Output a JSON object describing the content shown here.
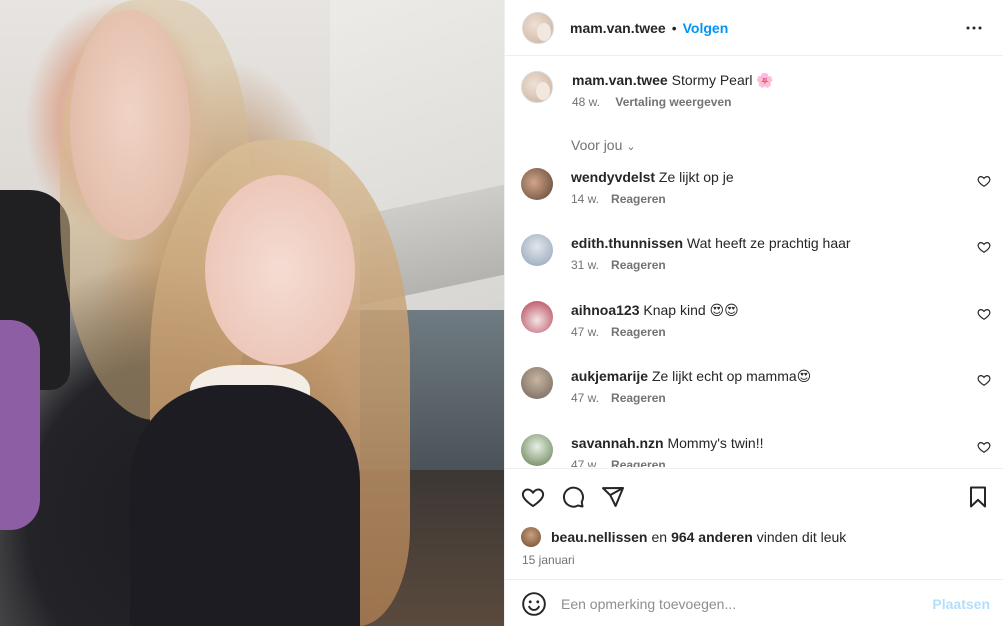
{
  "post": {
    "username": "mam.van.twee",
    "separator": "•",
    "follow_label": "Volgen",
    "more_icon": "more-horizontal-icon"
  },
  "caption": {
    "username": "mam.van.twee",
    "text": "Stormy Pearl 🌸",
    "age": "48 w.",
    "translate_label": "Vertaling weergeven"
  },
  "sort_label": "Voor jou",
  "comments": [
    {
      "username": "wendyvdelst",
      "text": "Ze lijkt op je",
      "age": "14 w.",
      "reply": "Reageren",
      "avatar_color": "#5a4232"
    },
    {
      "username": "edith.thunnissen",
      "text": "Wat heeft ze prachtig haar",
      "age": "31 w.",
      "reply": "Reageren",
      "avatar_color": "#8fa2b8"
    },
    {
      "username": "aihnoa123",
      "text": "Knap kind 😍😍",
      "age": "47 w.",
      "reply": "Reageren",
      "avatar_color": "#b23a4e"
    },
    {
      "username": "aukjemarije",
      "text": "Ze lijkt echt op mamma😍",
      "age": "47 w.",
      "reply": "Reageren",
      "avatar_color": "#6e6458"
    },
    {
      "username": "savannah.nzn",
      "text": "Mommy's twin!!",
      "age": "47 w.",
      "reply": "Reageren",
      "avatar_color": "#5f7d4e"
    }
  ],
  "likes": {
    "first_user": "beau.nellissen",
    "joiner": "en",
    "count_text": "964 anderen",
    "suffix": "vinden dit leuk"
  },
  "date": "15 januari",
  "comment_input": {
    "placeholder": "Een opmerking toevoegen...",
    "value": "",
    "post_label": "Plaatsen"
  },
  "colors": {
    "link_blue": "#0095f6",
    "post_disabled": "#b2dffc",
    "muted": "#737373",
    "border": "#efefef"
  }
}
